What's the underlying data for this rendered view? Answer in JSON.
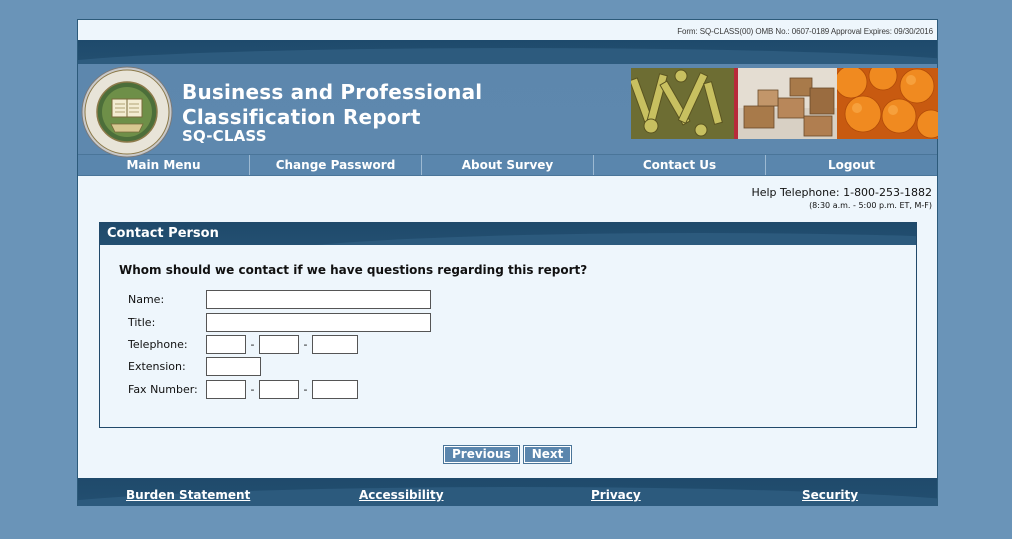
{
  "header": {
    "form_info": "Form: SQ-CLASS(00) OMB No.: 0607-0189 Approval Expires: 09/30/2016",
    "title_line1": "Business and Professional",
    "title_line2": "Classification Report",
    "title_line3": "SQ-CLASS",
    "seal_icon": "census-bureau-seal-icon"
  },
  "nav": {
    "items": [
      {
        "label": "Main Menu"
      },
      {
        "label": "Change Password"
      },
      {
        "label": "About Survey"
      },
      {
        "label": "Contact Us"
      },
      {
        "label": "Logout"
      }
    ]
  },
  "help": {
    "phone": "Help Telephone: 1-800-253-1882",
    "hours": "(8:30 a.m. - 5:00 p.m. ET, M-F)"
  },
  "panel": {
    "title": "Contact Person",
    "question": "Whom should we contact if we have questions regarding this report?",
    "fields": {
      "name_label": "Name:",
      "title_label": "Title:",
      "telephone_label": "Telephone:",
      "extension_label": "Extension:",
      "fax_label": "Fax Number:",
      "dash": "-"
    },
    "values": {
      "name": "",
      "title": "",
      "tel_area": "",
      "tel_prefix": "",
      "tel_line": "",
      "extension": "",
      "fax_area": "",
      "fax_prefix": "",
      "fax_line": ""
    }
  },
  "buttons": {
    "previous": "Previous",
    "next": "Next"
  },
  "footer": {
    "links": [
      {
        "label": "Burden Statement"
      },
      {
        "label": "Accessibility"
      },
      {
        "label": "Privacy"
      },
      {
        "label": "Security"
      }
    ]
  },
  "colors": {
    "page_bg": "#6a94b8",
    "banner": "#5e88ae",
    "dark_band": "#234f70",
    "content_bg": "#eef6fc"
  }
}
